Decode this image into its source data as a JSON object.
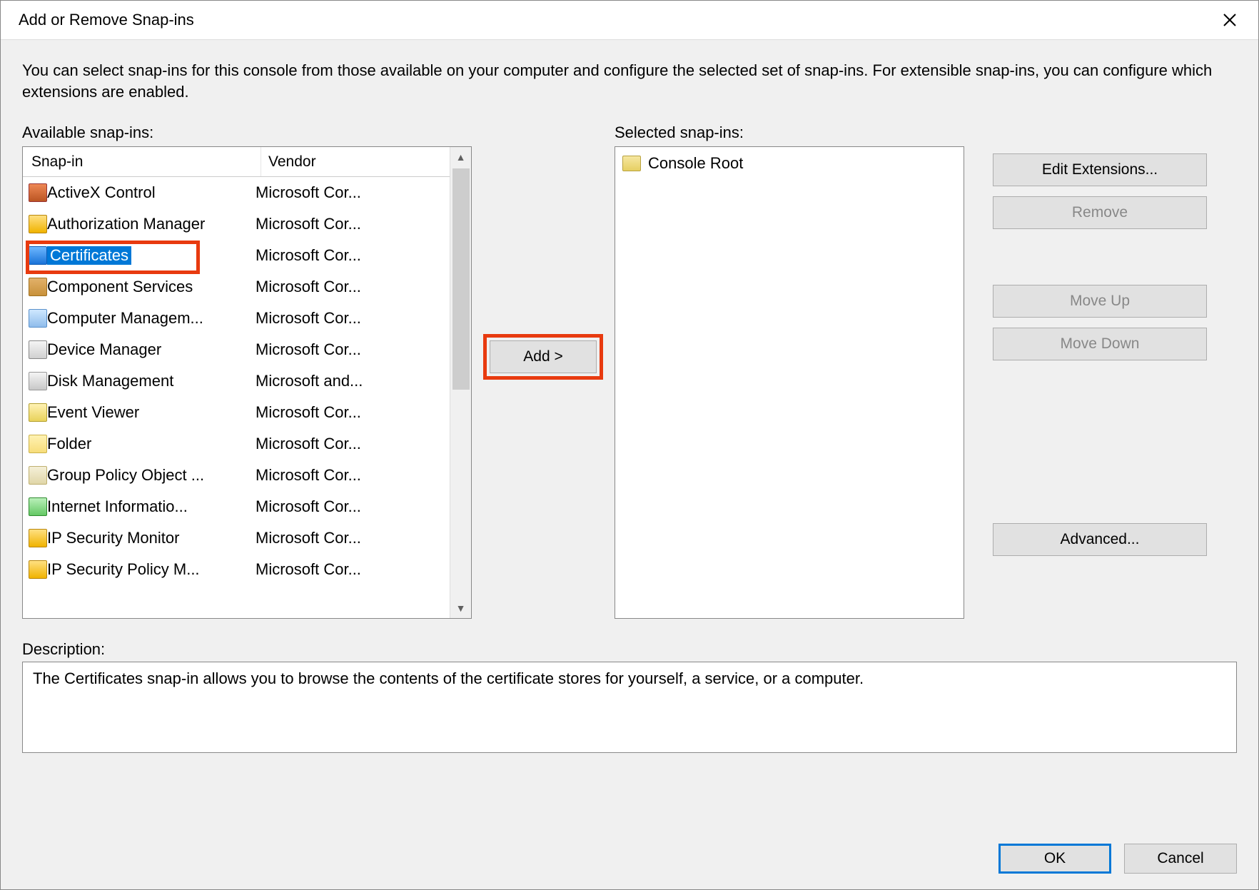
{
  "title": "Add or Remove Snap-ins",
  "instructions": "You can select snap-ins for this console from those available on your computer and configure the selected set of snap-ins. For extensible snap-ins, you can configure which extensions are enabled.",
  "labels": {
    "available": "Available snap-ins:",
    "selected": "Selected snap-ins:",
    "description": "Description:"
  },
  "columns": {
    "snapin": "Snap-in",
    "vendor": "Vendor"
  },
  "available_snapins": [
    {
      "name": "ActiveX Control",
      "vendor": "Microsoft Cor...",
      "icon": "ico-activex",
      "selected": false
    },
    {
      "name": "Authorization Manager",
      "vendor": "Microsoft Cor...",
      "icon": "ico-auth",
      "selected": false
    },
    {
      "name": "Certificates",
      "vendor": "Microsoft Cor...",
      "icon": "ico-cert",
      "selected": true
    },
    {
      "name": "Component Services",
      "vendor": "Microsoft Cor...",
      "icon": "ico-comp",
      "selected": false
    },
    {
      "name": "Computer Managem...",
      "vendor": "Microsoft Cor...",
      "icon": "ico-compmgmt",
      "selected": false
    },
    {
      "name": "Device Manager",
      "vendor": "Microsoft Cor...",
      "icon": "ico-device",
      "selected": false
    },
    {
      "name": "Disk Management",
      "vendor": "Microsoft and...",
      "icon": "ico-disk",
      "selected": false
    },
    {
      "name": "Event Viewer",
      "vendor": "Microsoft Cor...",
      "icon": "ico-event",
      "selected": false
    },
    {
      "name": "Folder",
      "vendor": "Microsoft Cor...",
      "icon": "ico-folder",
      "selected": false
    },
    {
      "name": "Group Policy Object ...",
      "vendor": "Microsoft Cor...",
      "icon": "ico-gpo",
      "selected": false
    },
    {
      "name": "Internet Informatio...",
      "vendor": "Microsoft Cor...",
      "icon": "ico-iis",
      "selected": false
    },
    {
      "name": "IP Security Monitor",
      "vendor": "Microsoft Cor...",
      "icon": "ico-ipsec1",
      "selected": false
    },
    {
      "name": "IP Security Policy M...",
      "vendor": "Microsoft Cor...",
      "icon": "ico-ipsec2",
      "selected": false
    }
  ],
  "selected_snapins": [
    {
      "name": "Console Root"
    }
  ],
  "buttons": {
    "add": "Add >",
    "edit_extensions": "Edit Extensions...",
    "remove": "Remove",
    "move_up": "Move Up",
    "move_down": "Move Down",
    "advanced": "Advanced...",
    "ok": "OK",
    "cancel": "Cancel"
  },
  "description_text": "The Certificates snap-in allows you to browse the contents of the certificate stores for yourself, a service, or a computer."
}
